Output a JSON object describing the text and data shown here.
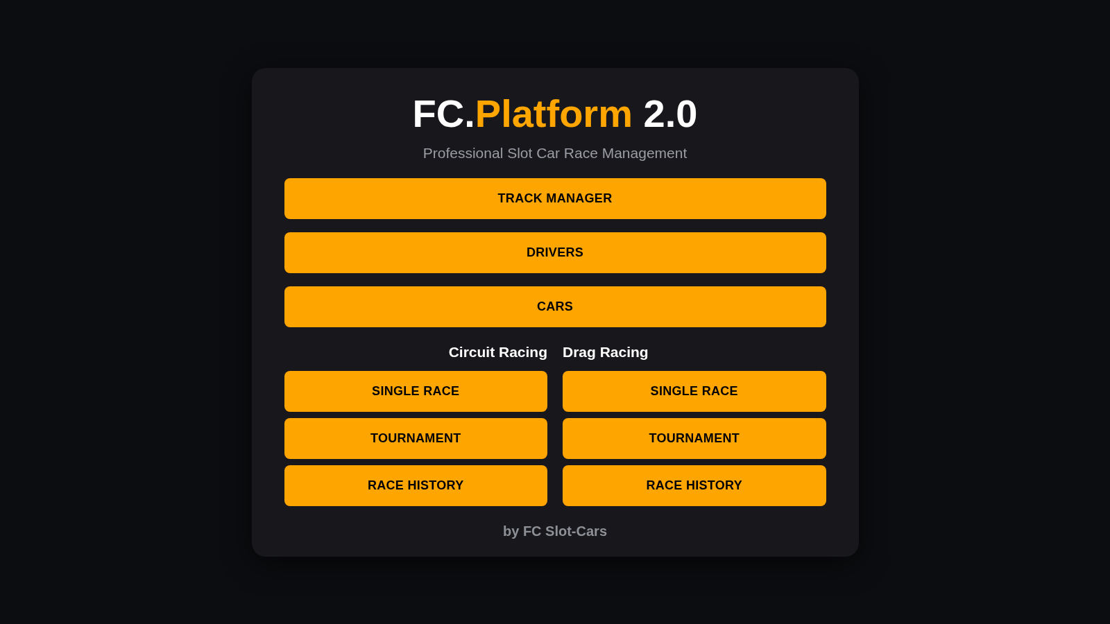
{
  "header": {
    "title": {
      "prefix": "FC.",
      "highlight": "Platform",
      "suffix": "2.0"
    },
    "subtitle": "Professional Slot Car Race Management"
  },
  "main_buttons": [
    "TRACK MANAGER",
    "DRIVERS",
    "CARS"
  ],
  "sections": [
    {
      "heading": "Circuit Racing",
      "buttons": [
        "SINGLE RACE",
        "TOURNAMENT",
        "RACE HISTORY"
      ]
    },
    {
      "heading": "Drag Racing",
      "buttons": [
        "SINGLE RACE",
        "TOURNAMENT",
        "RACE HISTORY"
      ]
    }
  ],
  "footer": "by FC Slot-Cars"
}
